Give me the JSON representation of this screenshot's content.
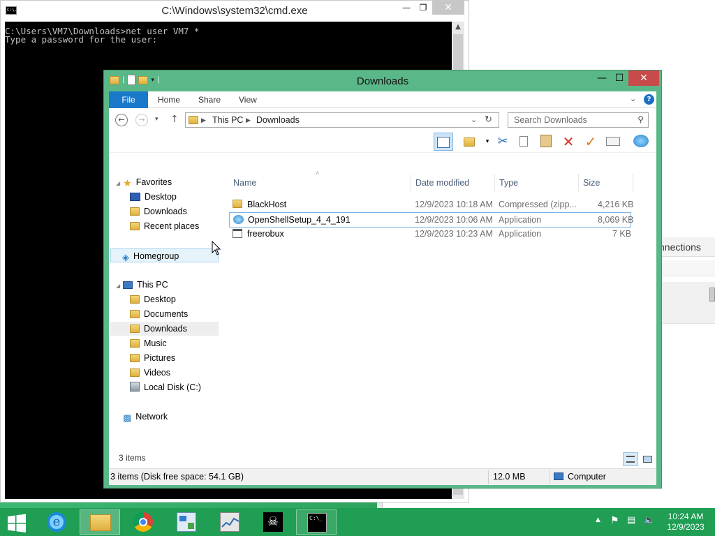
{
  "cmd": {
    "title": "C:\\Windows\\system32\\cmd.exe",
    "icon_text": "C:\\.",
    "line1": "C:\\Users\\VM7\\Downloads>net user VM7 *",
    "line2": "Type a password for the user:"
  },
  "background_window": {
    "connections_text": "nnections"
  },
  "explorer": {
    "title": "Downloads",
    "ribbon_tabs": [
      "File",
      "Home",
      "Share",
      "View"
    ],
    "breadcrumb": [
      "This PC",
      "Downloads"
    ],
    "search_placeholder": "Search Downloads",
    "nav": {
      "favorites": "Favorites",
      "favorites_items": [
        "Desktop",
        "Downloads",
        "Recent places"
      ],
      "homegroup": "Homegroup",
      "this_pc": "This PC",
      "this_pc_items": [
        "Desktop",
        "Documents",
        "Downloads",
        "Music",
        "Pictures",
        "Videos",
        "Local Disk (C:)"
      ],
      "network": "Network"
    },
    "columns": [
      "Name",
      "Date modified",
      "Type",
      "Size"
    ],
    "files": [
      {
        "name": "BlackHost",
        "date": "12/9/2023 10:18 AM",
        "type": "Compressed (zipp...",
        "size": "4,216 KB",
        "icon": "zip-folder-icon"
      },
      {
        "name": "OpenShellSetup_4_4_191",
        "date": "12/9/2023 10:06 AM",
        "type": "Application",
        "size": "8,069 KB",
        "icon": "openshell-icon"
      },
      {
        "name": "freerobux",
        "date": "12/9/2023 10:23 AM",
        "type": "Application",
        "size": "7 KB",
        "icon": "application-icon"
      }
    ],
    "item_count": "3 items",
    "status": {
      "left": "3 items (Disk free space: 54.1 GB)",
      "size": "12.0 MB",
      "location": "Computer"
    }
  },
  "taskbar": {
    "time": "10:24 AM",
    "date": "12/9/2023"
  }
}
